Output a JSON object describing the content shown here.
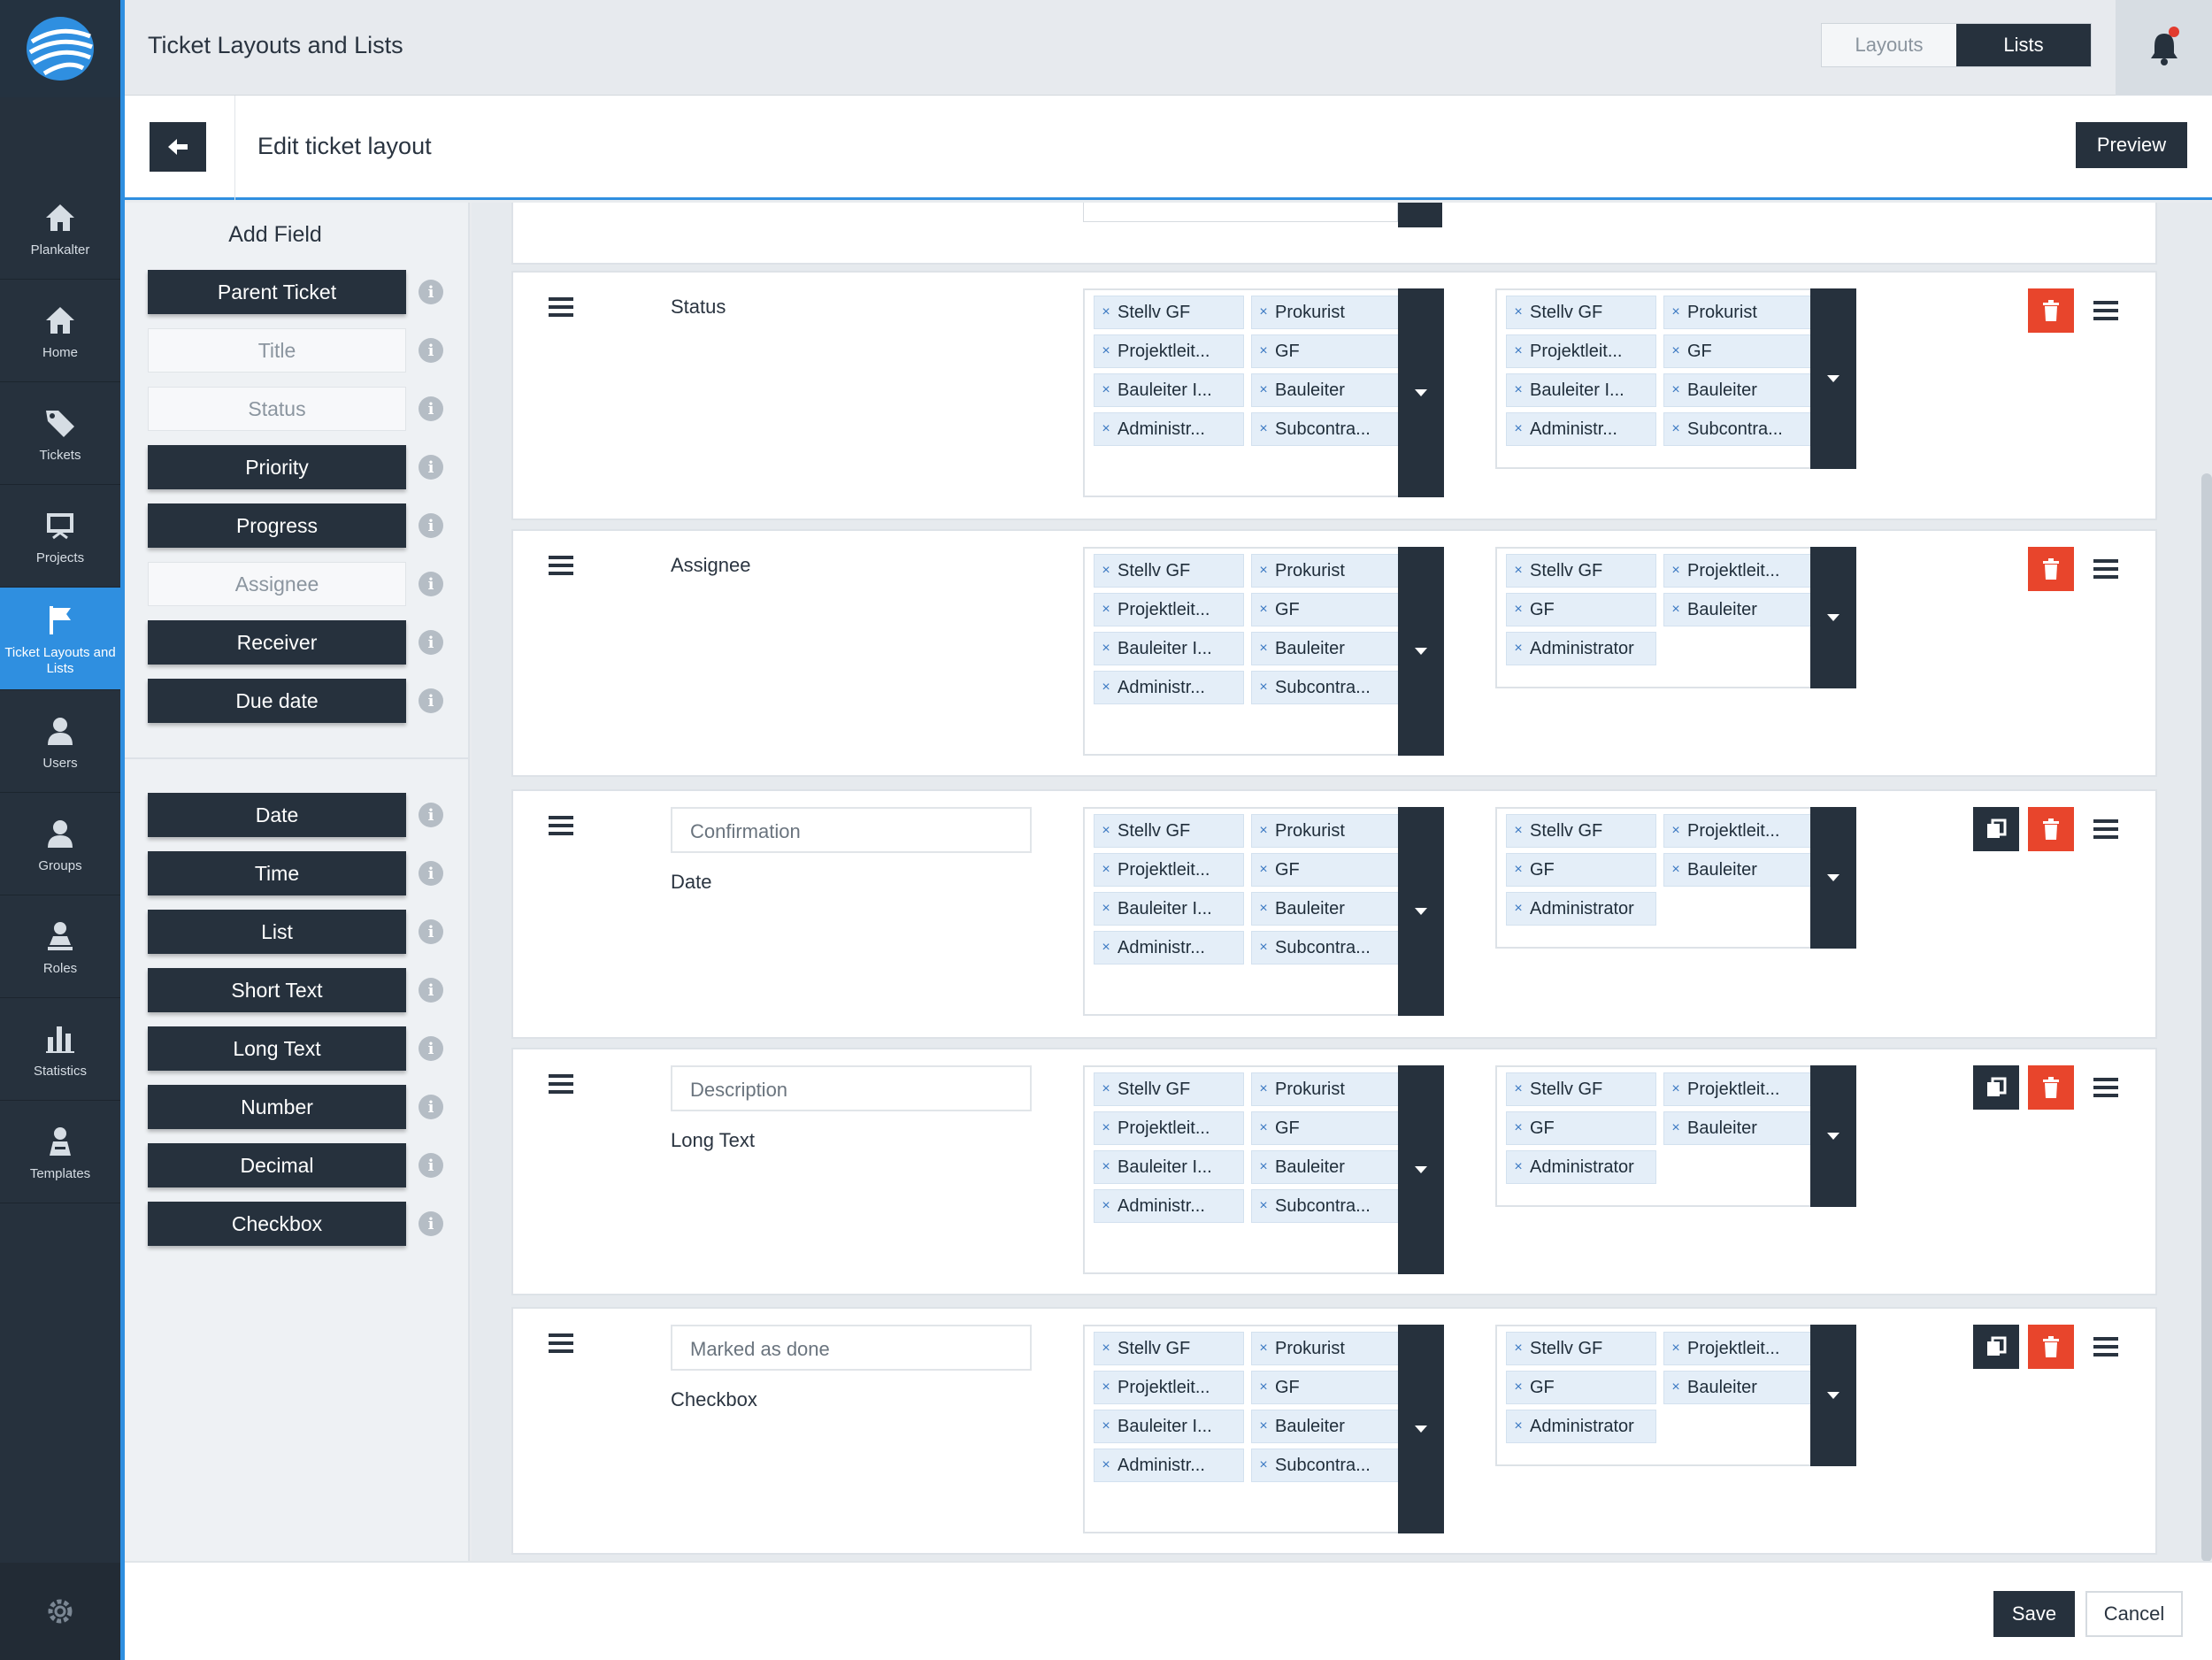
{
  "colors": {
    "navy": "#26313d",
    "accent": "#2f8fe0",
    "danger": "#e8452c",
    "tag_bg": "#e4eef8"
  },
  "nav": {
    "items": [
      {
        "label": "Plankalter",
        "icon": "home-icon"
      },
      {
        "label": "Home",
        "icon": "home-icon"
      },
      {
        "label": "Tickets",
        "icon": "tag-icon"
      },
      {
        "label": "Projects",
        "icon": "blueprint-icon"
      },
      {
        "label": "Ticket Layouts and Lists",
        "icon": "flag-icon",
        "active": true
      },
      {
        "label": "Users",
        "icon": "user-icon"
      },
      {
        "label": "Groups",
        "icon": "group-icon"
      },
      {
        "label": "Roles",
        "icon": "role-icon"
      },
      {
        "label": "Statistics",
        "icon": "bar-chart-icon"
      },
      {
        "label": "Templates",
        "icon": "template-icon"
      }
    ]
  },
  "topbar": {
    "title": "Ticket Layouts and Lists",
    "toggle": [
      "Layouts",
      "Lists"
    ],
    "selected": "Lists"
  },
  "subheader": {
    "title": "Edit ticket layout",
    "preview_label": "Preview"
  },
  "palette": {
    "header": "Add Field",
    "group1": [
      {
        "label": "Parent Ticket",
        "style": "dark"
      },
      {
        "label": "Title",
        "style": "light"
      },
      {
        "label": "Status",
        "style": "light"
      },
      {
        "label": "Priority",
        "style": "dark"
      },
      {
        "label": "Progress",
        "style": "dark"
      },
      {
        "label": "Assignee",
        "style": "light"
      },
      {
        "label": "Receiver",
        "style": "dark"
      },
      {
        "label": "Due date",
        "style": "dark"
      }
    ],
    "group2": [
      {
        "label": "Date"
      },
      {
        "label": "Time"
      },
      {
        "label": "List"
      },
      {
        "label": "Short Text"
      },
      {
        "label": "Long Text"
      },
      {
        "label": "Number"
      },
      {
        "label": "Decimal"
      },
      {
        "label": "Checkbox"
      }
    ]
  },
  "rows": [
    {
      "label": "Status",
      "editable": false,
      "read_roles": [
        "Stellv GF",
        "Prokurist",
        "Projektleit...",
        "GF",
        "Bauleiter I...",
        "Bauleiter",
        "Administr...",
        "Subcontra..."
      ],
      "write_roles": [
        "Stellv GF",
        "Prokurist",
        "Projektleit...",
        "GF",
        "Bauleiter I...",
        "Bauleiter",
        "Administr...",
        "Subcontra..."
      ]
    },
    {
      "label": "Assignee",
      "editable": false,
      "read_roles": [
        "Stellv GF",
        "Prokurist",
        "Projektleit...",
        "GF",
        "Bauleiter I...",
        "Bauleiter",
        "Administr...",
        "Subcontra..."
      ],
      "write_roles": [
        "Stellv GF",
        "Projektleit...",
        "GF",
        "Bauleiter",
        "Administrator"
      ]
    },
    {
      "label": "Confirmation",
      "type": "Date",
      "editable": true,
      "read_roles": [
        "Stellv GF",
        "Prokurist",
        "Projektleit...",
        "GF",
        "Bauleiter I...",
        "Bauleiter",
        "Administr...",
        "Subcontra..."
      ],
      "write_roles": [
        "Stellv GF",
        "Projektleit...",
        "GF",
        "Bauleiter",
        "Administrator"
      ]
    },
    {
      "label": "Description",
      "type": "Long Text",
      "editable": true,
      "read_roles": [
        "Stellv GF",
        "Prokurist",
        "Projektleit...",
        "GF",
        "Bauleiter I...",
        "Bauleiter",
        "Administr...",
        "Subcontra..."
      ],
      "write_roles": [
        "Stellv GF",
        "Projektleit...",
        "GF",
        "Bauleiter",
        "Administrator"
      ]
    },
    {
      "label": "Marked as done",
      "type": "Checkbox",
      "editable": true,
      "read_roles": [
        "Stellv GF",
        "Prokurist",
        "Projektleit...",
        "GF",
        "Bauleiter I...",
        "Bauleiter",
        "Administr...",
        "Subcontra..."
      ],
      "write_roles": [
        "Stellv GF",
        "Projektleit...",
        "GF",
        "Bauleiter",
        "Administrator"
      ]
    }
  ],
  "footer": {
    "save_label": "Save",
    "cancel_label": "Cancel"
  }
}
